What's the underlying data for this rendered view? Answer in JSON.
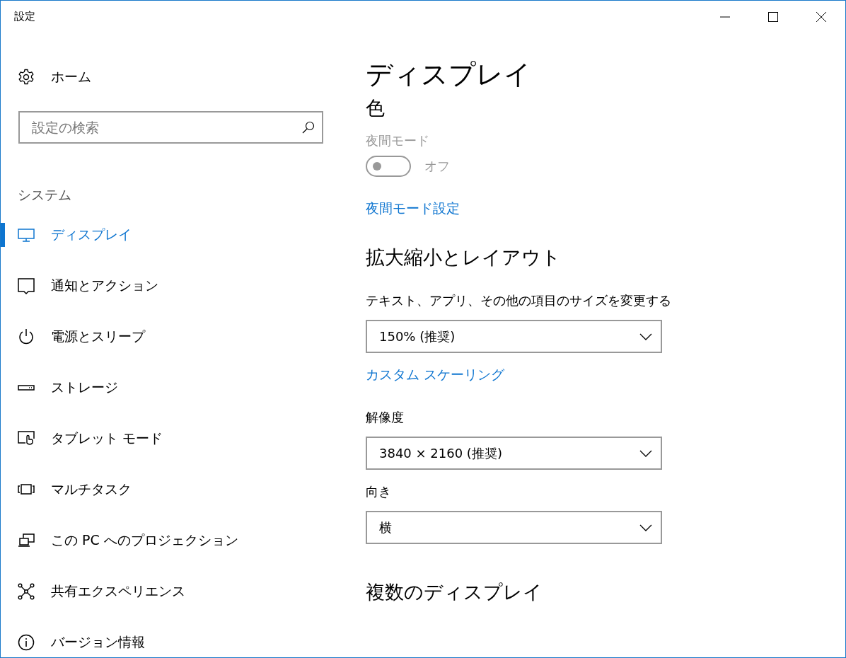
{
  "window": {
    "title": "設定"
  },
  "sidebar": {
    "home": {
      "label": "ホーム"
    },
    "search": {
      "placeholder": "設定の検索"
    },
    "section": "システム",
    "items": [
      {
        "kind": "display",
        "label": "ディスプレイ",
        "selected": true
      },
      {
        "kind": "notification",
        "label": "通知とアクション",
        "selected": false
      },
      {
        "kind": "power",
        "label": "電源とスリープ",
        "selected": false
      },
      {
        "kind": "storage",
        "label": "ストレージ",
        "selected": false
      },
      {
        "kind": "tablet",
        "label": "タブレット モード",
        "selected": false
      },
      {
        "kind": "multitask",
        "label": "マルチタスク",
        "selected": false
      },
      {
        "kind": "projection",
        "label": "この PC へのプロジェクション",
        "selected": false
      },
      {
        "kind": "share",
        "label": "共有エクスペリエンス",
        "selected": false
      },
      {
        "kind": "info",
        "label": "バージョン情報",
        "selected": false
      }
    ]
  },
  "content": {
    "title": "ディスプレイ",
    "sections": [
      {
        "kind": "heading",
        "text": "色"
      },
      {
        "kind": "toggle",
        "label": "夜間モード",
        "on": false,
        "disabled": true,
        "state_text": "オフ"
      },
      {
        "kind": "link",
        "text": "夜間モード設定"
      },
      {
        "kind": "heading",
        "text": "拡大縮小とレイアウト"
      },
      {
        "kind": "dropdown",
        "label": "テキスト、アプリ、その他の項目のサイズを変更する",
        "value": "150% (推奨)"
      },
      {
        "kind": "link",
        "text": "カスタム スケーリング"
      },
      {
        "kind": "dropdown",
        "label": "解像度",
        "value": "3840 × 2160 (推奨)"
      },
      {
        "kind": "dropdown",
        "label": "向き",
        "value": "横"
      },
      {
        "kind": "heading",
        "text": "複数のディスプレイ"
      }
    ]
  }
}
